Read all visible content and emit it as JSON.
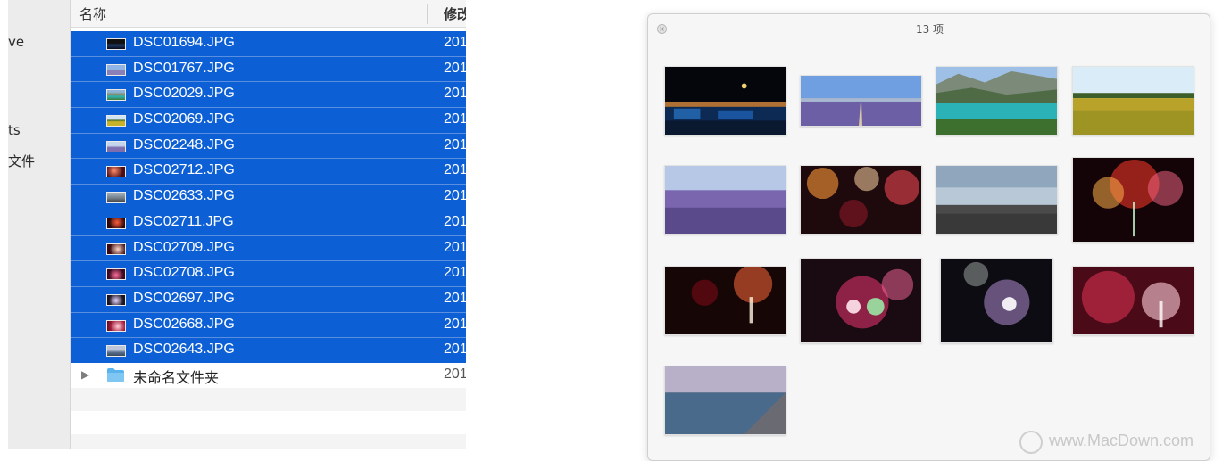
{
  "finder": {
    "sidebar": {
      "items": [
        "ve",
        "ts",
        "文件"
      ]
    },
    "columns": {
      "name": "名称",
      "modified": "修改"
    },
    "files": [
      {
        "name": "DSC01694.JPG",
        "date": "201"
      },
      {
        "name": "DSC01767.JPG",
        "date": "201"
      },
      {
        "name": "DSC02029.JPG",
        "date": "201"
      },
      {
        "name": "DSC02069.JPG",
        "date": "201"
      },
      {
        "name": "DSC02248.JPG",
        "date": "201"
      },
      {
        "name": "DSC02712.JPG",
        "date": "201"
      },
      {
        "name": "DSC02633.JPG",
        "date": "201"
      },
      {
        "name": "DSC02711.JPG",
        "date": "201"
      },
      {
        "name": "DSC02709.JPG",
        "date": "201"
      },
      {
        "name": "DSC02708.JPG",
        "date": "201"
      },
      {
        "name": "DSC02697.JPG",
        "date": "201"
      },
      {
        "name": "DSC02668.JPG",
        "date": "201"
      },
      {
        "name": "DSC02643.JPG",
        "date": "201"
      }
    ],
    "folder": {
      "name": "未命名文件夹",
      "date": "201"
    }
  },
  "quicklook": {
    "title": "13 项",
    "tiles": [
      "night-harbor-photo",
      "lavender-field-horizon-photo",
      "mountain-lake-photo",
      "sunflower-field-photo",
      "lavender-closeup-photo",
      "fireworks-photo",
      "pebble-beach-waves-photo",
      "fireworks-photo",
      "fireworks-photo",
      "fireworks-photo",
      "fireworks-photo",
      "fireworks-photo",
      "sunset-beach-photo"
    ]
  },
  "watermark": "www.MacDown.com",
  "colors": {
    "selection": "#0d5fd6",
    "folder": "#5ab3ec"
  }
}
